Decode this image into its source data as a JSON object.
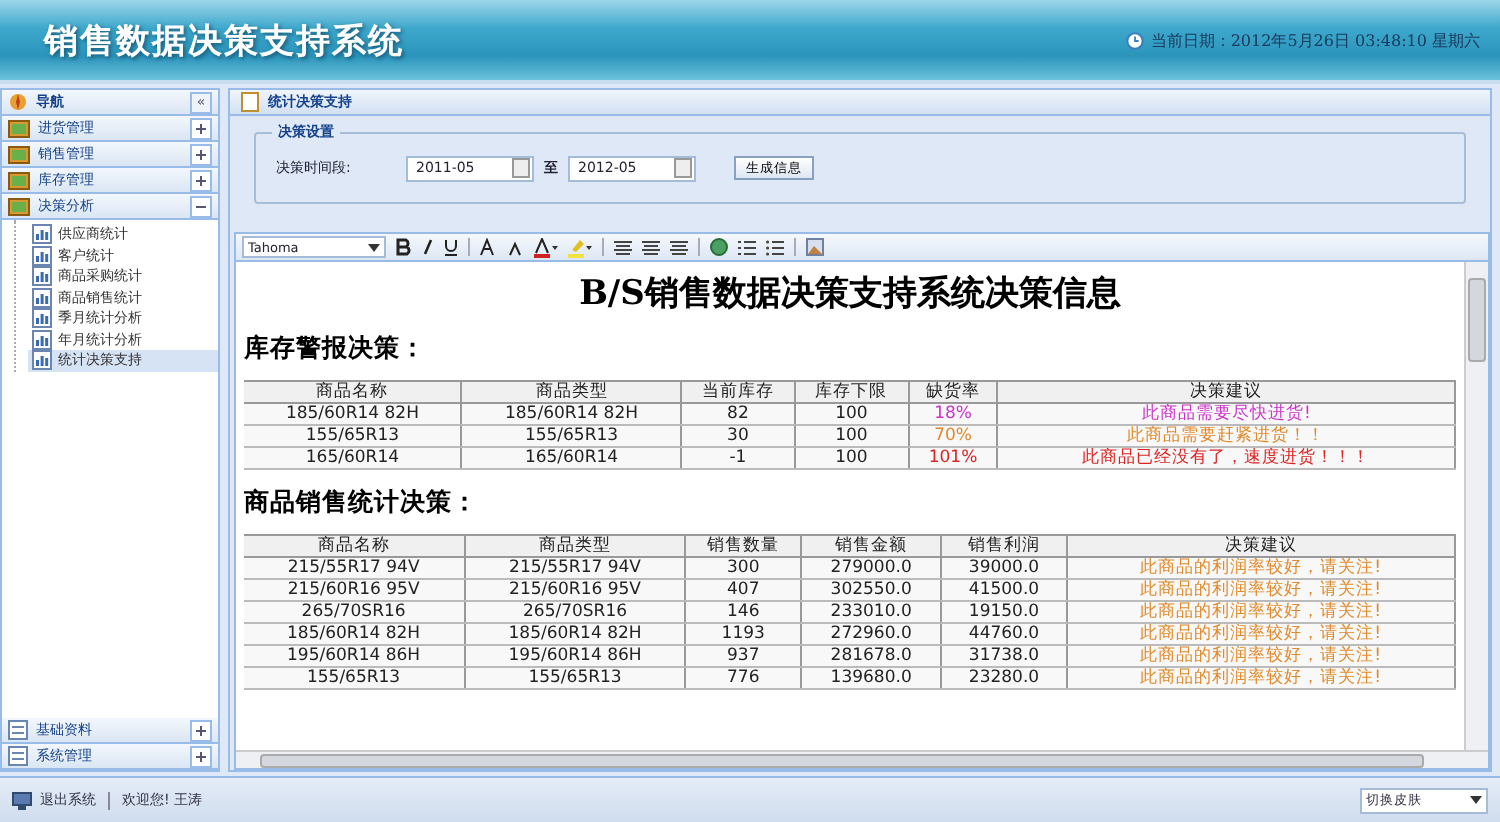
{
  "header": {
    "title": "销售数据决策支持系统",
    "date_text": "当前日期：2012年5月26日  03:48:10 星期六"
  },
  "sidebar": {
    "title": "导航",
    "collapse": "«",
    "groups": [
      {
        "label": "进货管理",
        "expanded": false
      },
      {
        "label": "销售管理",
        "expanded": false
      },
      {
        "label": "库存管理",
        "expanded": false
      },
      {
        "label": "决策分析",
        "expanded": true,
        "children": [
          {
            "label": "供应商统计",
            "selected": false
          },
          {
            "label": "客户统计",
            "selected": false
          },
          {
            "label": "商品采购统计",
            "selected": false
          },
          {
            "label": "商品销售统计",
            "selected": false
          },
          {
            "label": "季月统计分析",
            "selected": false
          },
          {
            "label": "年月统计分析",
            "selected": false
          },
          {
            "label": "统计决策支持",
            "selected": true
          }
        ]
      }
    ],
    "bottom_groups": [
      {
        "label": "基础资料",
        "expanded": false
      },
      {
        "label": "系统管理",
        "expanded": false
      }
    ]
  },
  "panel": {
    "title": "统计决策支持",
    "settings": {
      "legend": "决策设置",
      "label": "决策时间段:",
      "from": "2011-05",
      "separator": "至",
      "to": "2012-05",
      "button": "生成信息"
    },
    "editor": {
      "font": "Tahoma",
      "heading": "B/S销售数据决策支持系统决策信息",
      "stock": {
        "title": "库存警报决策：",
        "columns": [
          "商品名称",
          "商品类型",
          "当前库存",
          "库存下限",
          "缺货率",
          "决策建议"
        ],
        "rows": [
          {
            "cells": [
              "185/60R14 82H",
              "185/60R14 82H",
              "82",
              "100",
              "18%",
              "此商品需要尽快进货!"
            ],
            "color": "#cc33cc"
          },
          {
            "cells": [
              "155/65R13",
              "155/65R13",
              "30",
              "100",
              "70%",
              "此商品需要赶紧进货！！"
            ],
            "color": "#e08a2a"
          },
          {
            "cells": [
              "165/60R14",
              "165/60R14",
              "-1",
              "100",
              "101%",
              "此商品已经没有了，速度进货！！！"
            ],
            "color": "#dd2222"
          }
        ]
      },
      "sales": {
        "title": "商品销售统计决策：",
        "columns": [
          "商品名称",
          "商品类型",
          "销售数量",
          "销售金额",
          "销售利润",
          "决策建议"
        ],
        "rows": [
          {
            "cells": [
              "215/55R17 94V",
              "215/55R17 94V",
              "300",
              "279000.0",
              "39000.0",
              "此商品的利润率较好，请关注!"
            ],
            "color": "#e08a2a"
          },
          {
            "cells": [
              "215/60R16 95V",
              "215/60R16 95V",
              "407",
              "302550.0",
              "41500.0",
              "此商品的利润率较好，请关注!"
            ],
            "color": "#e08a2a"
          },
          {
            "cells": [
              "265/70SR16",
              "265/70SR16",
              "146",
              "233010.0",
              "19150.0",
              "此商品的利润率较好，请关注!"
            ],
            "color": "#e08a2a"
          },
          {
            "cells": [
              "185/60R14 82H",
              "185/60R14 82H",
              "1193",
              "272960.0",
              "44760.0",
              "此商品的利润率较好，请关注!"
            ],
            "color": "#e08a2a"
          },
          {
            "cells": [
              "195/60R14 86H",
              "195/60R14 86H",
              "937",
              "281678.0",
              "31738.0",
              "此商品的利润率较好，请关注!"
            ],
            "color": "#e08a2a"
          },
          {
            "cells": [
              "155/65R13",
              "155/65R13",
              "776",
              "139680.0",
              "23280.0",
              "此商品的利润率较好，请关注!"
            ],
            "color": "#e08a2a"
          }
        ]
      }
    }
  },
  "status_bar": {
    "logout": "退出系统",
    "welcome": "欢迎您! 王涛",
    "skin": "切换皮肤"
  }
}
